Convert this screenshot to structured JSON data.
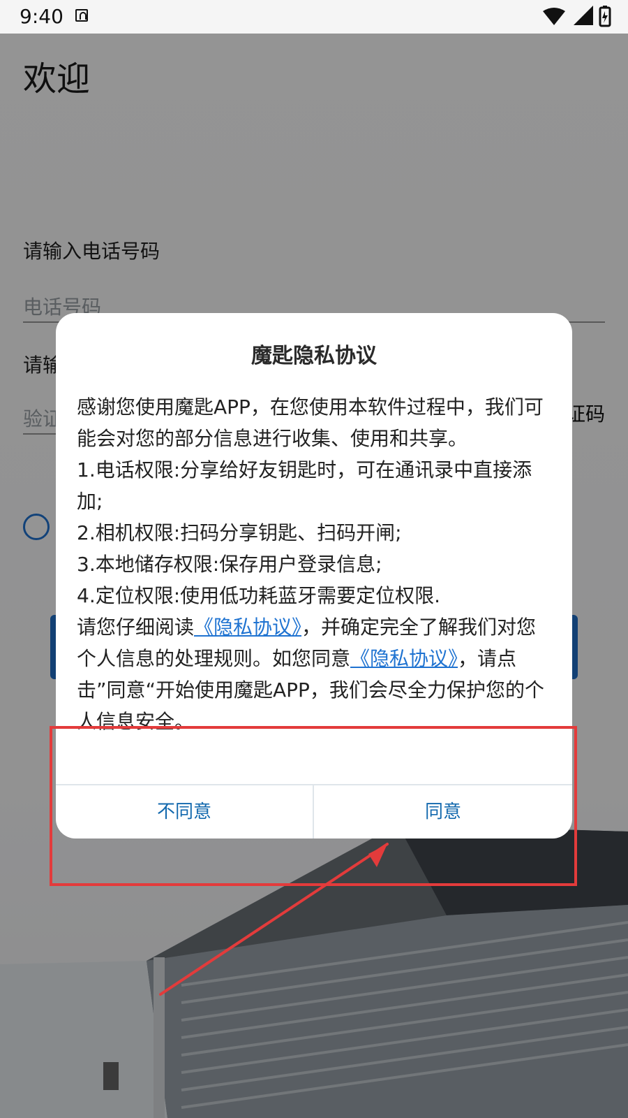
{
  "status_bar": {
    "time": "9:40",
    "icons": [
      "wifi-icon",
      "signal-icon",
      "battery-icon"
    ]
  },
  "login": {
    "welcome": "欢迎",
    "phone_label": "请输入电话号码",
    "phone_placeholder": "电话号码",
    "code_label": "请输",
    "code_placeholder": "验证",
    "get_code": "证码"
  },
  "dialog": {
    "title": "魔匙隐私协议",
    "paragraphs": [
      "感谢您使用魔匙APP，在您使用本软件过程中，我们可能会对您的部分信息进行收集、使用和共享。",
      "1.电话权限:分享给好友钥匙时，可在通讯录中直接添加;",
      "2.相机权限:扫码分享钥匙、扫码开闸;",
      "3.本地储存权限:保存用户登录信息;",
      "4.定位权限:使用低功耗蓝牙需要定位权限."
    ],
    "notice": {
      "prefix": "请您仔细阅读",
      "link1": "《隐私协议》",
      "middle": "，并确定完全了解我们对您个人信息的处理规则。如您同意",
      "link2": "《隐私协议》",
      "suffix": "，请点击”同意“开始使用魔匙APP，我们会尽全力保护您的个人信息安全。"
    },
    "disagree_label": "不同意",
    "agree_label": "同意"
  },
  "colors": {
    "accent": "#1f73d1",
    "button_text": "#1369ae",
    "annotation": "#e33b3b"
  }
}
